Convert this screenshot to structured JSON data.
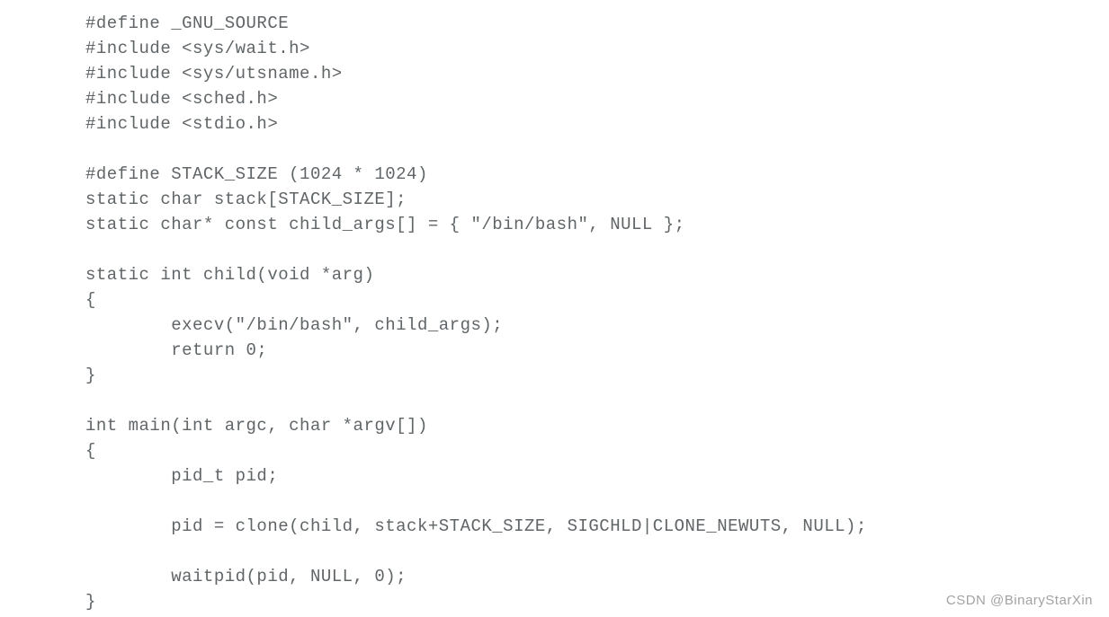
{
  "code": {
    "lines": [
      "#define _GNU_SOURCE",
      "#include <sys/wait.h>",
      "#include <sys/utsname.h>",
      "#include <sched.h>",
      "#include <stdio.h>",
      "",
      "#define STACK_SIZE (1024 * 1024)",
      "static char stack[STACK_SIZE];",
      "static char* const child_args[] = { \"/bin/bash\", NULL };",
      "",
      "static int child(void *arg)",
      "{",
      "        execv(\"/bin/bash\", child_args);",
      "        return 0;",
      "}",
      "",
      "int main(int argc, char *argv[])",
      "{",
      "        pid_t pid;",
      "",
      "        pid = clone(child, stack+STACK_SIZE, SIGCHLD|CLONE_NEWUTS, NULL);",
      "",
      "        waitpid(pid, NULL, 0);",
      "}"
    ]
  },
  "watermark": "CSDN @BinaryStarXin"
}
